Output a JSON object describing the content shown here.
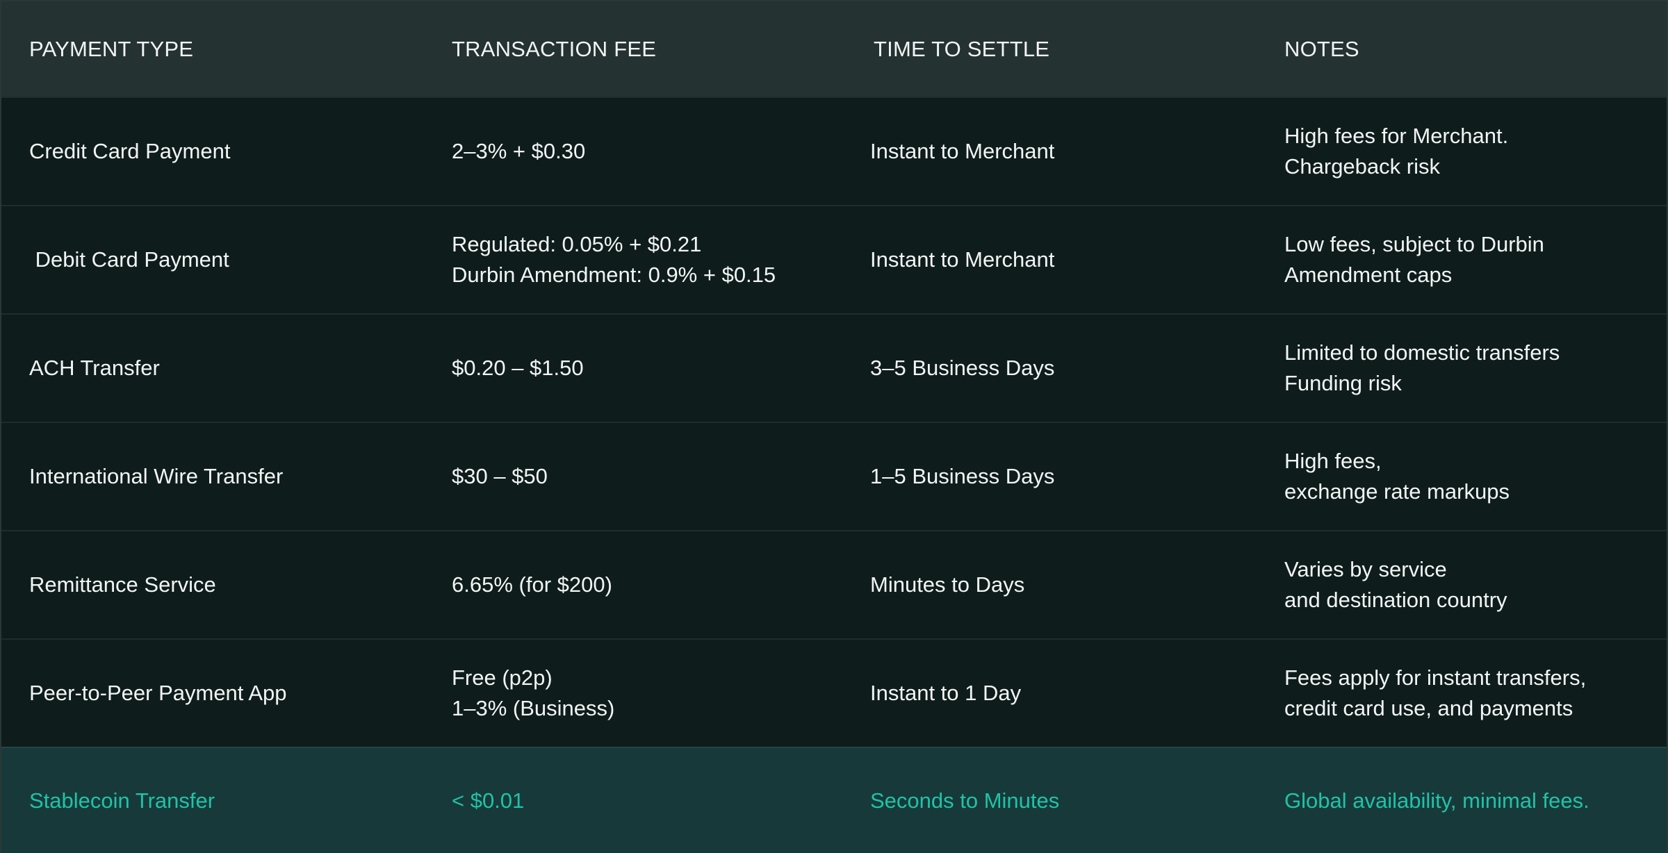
{
  "header": {
    "payment_type": "PAYMENT TYPE",
    "transaction_fee": "TRANSACTION FEE",
    "time_to_settle": "TIME TO SETTLE",
    "notes": "NOTES"
  },
  "rows": [
    {
      "payment_type": "Credit Card Payment",
      "fee_line1": "2–3% + $0.30",
      "fee_line2": "",
      "settle": "Instant to Merchant",
      "notes_line1": "High fees for Merchant.",
      "notes_line2": "Chargeback risk"
    },
    {
      "payment_type": " Debit Card Payment",
      "fee_line1": "Regulated: 0.05% + $0.21",
      "fee_line2": "Durbin Amendment: 0.9% + $0.15",
      "settle": "Instant to Merchant",
      "notes_line1": "Low fees, subject to Durbin",
      "notes_line2": "Amendment caps"
    },
    {
      "payment_type": "ACH Transfer",
      "fee_line1": "$0.20 – $1.50",
      "fee_line2": "",
      "settle": "3–5 Business Days",
      "notes_line1": "Limited to domestic transfers",
      "notes_line2": "Funding risk"
    },
    {
      "payment_type": "International Wire Transfer",
      "fee_line1": "$30 – $50",
      "fee_line2": "",
      "settle": "1–5 Business Days",
      "notes_line1": "High fees,",
      "notes_line2": "exchange rate markups"
    },
    {
      "payment_type": "Remittance Service",
      "fee_line1": "6.65% (for $200)",
      "fee_line2": "",
      "settle": "Minutes to Days",
      "notes_line1": "Varies by service",
      "notes_line2": "and destination country"
    },
    {
      "payment_type": "Peer-to-Peer Payment App",
      "fee_line1": "Free (p2p)",
      "fee_line2": "1–3% (Business)",
      "settle": "Instant to 1 Day",
      "notes_line1": "Fees apply for instant transfers,",
      "notes_line2": "credit card use, and payments"
    },
    {
      "payment_type": "Stablecoin Transfer",
      "fee_line1": "< $0.01",
      "fee_line2": "",
      "settle": "Seconds to Minutes",
      "notes_line1": "Global availability, minimal fees.",
      "notes_line2": ""
    }
  ],
  "colors": {
    "background": "#0e1d1c",
    "header_background": "#243231",
    "highlight_background": "#18393a",
    "highlight_text": "#20c3a7",
    "text": "#f2f5f4"
  }
}
